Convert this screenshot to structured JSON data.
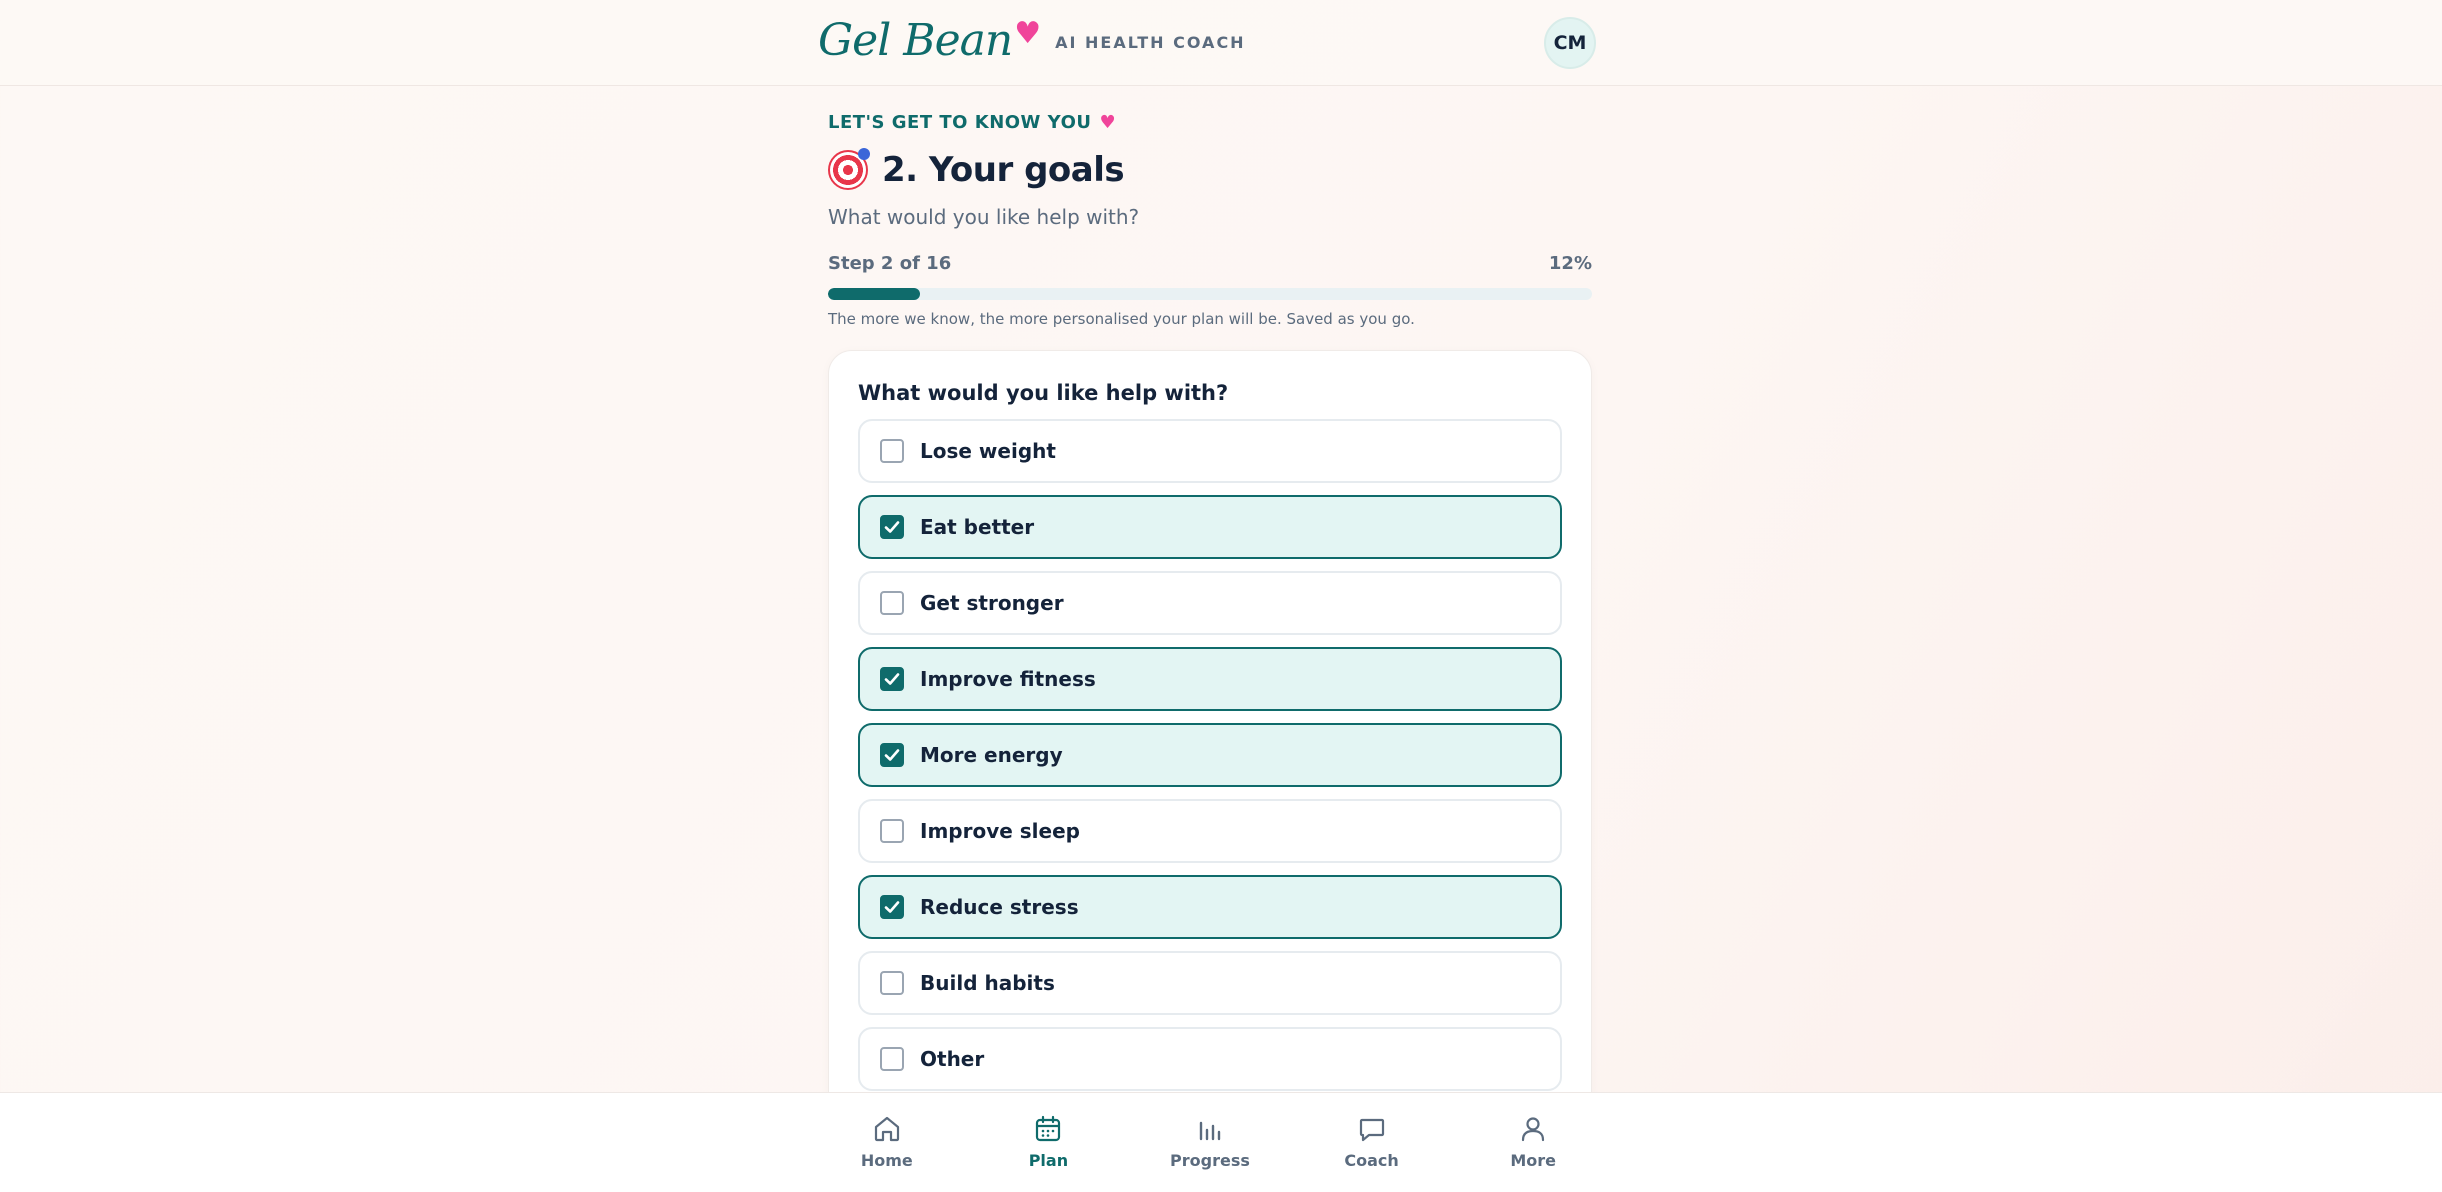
{
  "header": {
    "logo_text": "Gel Bean",
    "tagline": "AI HEALTH COACH",
    "avatar_initials": "CM"
  },
  "intro": {
    "eyebrow": "LET'S GET TO KNOW YOU",
    "title": "2. Your goals",
    "subtitle": "What would you like help with?",
    "step_label": "Step 2 of 16",
    "percent_label": "12%",
    "progress_fraction": 0.12,
    "hint": "The more we know, the more personalised your plan will be. Saved as you go."
  },
  "card": {
    "question": "What would you like help with?",
    "options": [
      {
        "label": "Lose weight",
        "checked": false
      },
      {
        "label": "Eat better",
        "checked": true
      },
      {
        "label": "Get stronger",
        "checked": false
      },
      {
        "label": "Improve fitness",
        "checked": true
      },
      {
        "label": "More energy",
        "checked": true
      },
      {
        "label": "Improve sleep",
        "checked": false
      },
      {
        "label": "Reduce stress",
        "checked": true
      },
      {
        "label": "Build habits",
        "checked": false
      },
      {
        "label": "Other",
        "checked": false
      }
    ]
  },
  "nav": {
    "items": [
      {
        "label": "Home",
        "icon": "home-icon",
        "active": false
      },
      {
        "label": "Plan",
        "icon": "calendar-icon",
        "active": true
      },
      {
        "label": "Progress",
        "icon": "bar-chart-icon",
        "active": false
      },
      {
        "label": "Coach",
        "icon": "chat-bubble-icon",
        "active": false
      },
      {
        "label": "More",
        "icon": "user-icon",
        "active": false
      }
    ]
  },
  "colors": {
    "accent": "#0f6b6b",
    "heart": "#f0449a",
    "checked_bg": "#e3f5f3"
  }
}
